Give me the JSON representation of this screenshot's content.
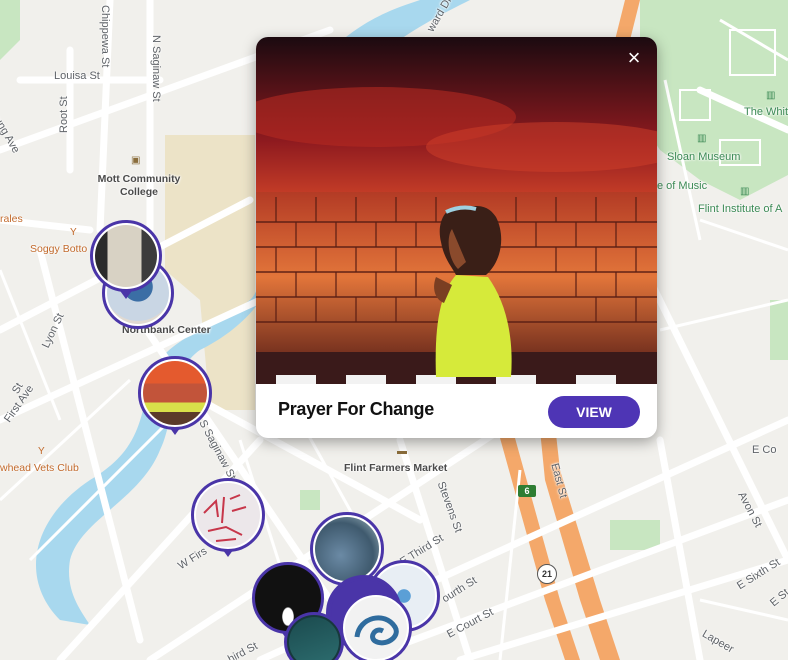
{
  "map": {
    "street_labels": {
      "louisa": "Louisa St",
      "chippewa": "Chippewa St",
      "n_saginaw": "N Saginaw St",
      "root": "Root St",
      "young": "ung Ave",
      "lyon": "Lyon St",
      "first_ave": "First Ave",
      "st_left": "St",
      "s_saginaw": "S Saginaw St",
      "w_first": "W Firs",
      "e_third": "E Third St",
      "stevens": "Stevens St",
      "fourth": "ourth St",
      "e_court": "E Court St",
      "third_bottom": "hird St",
      "east_st": "East St",
      "e_sixth": "E Sixth St",
      "e_co": "E Co",
      "avon": "Avon St",
      "e_st": "E St",
      "lapeer": "Lapeer",
      "ward_dr": "ward Dr"
    },
    "place_labels": {
      "mott_college": "Mott Community College",
      "northbank": "Northbank Center",
      "flint_farmers": "Flint Farmers Market",
      "sloan": "Sloan Museum",
      "music": "e of Music",
      "flint_institute": "Flint Institute of A",
      "the_whit": "The Whit",
      "soggy": "Soggy Botto",
      "ales": "rales",
      "vets_club": "whead Vets Club"
    },
    "route_shields": {
      "highway_475": "6",
      "route_21": "21"
    }
  },
  "popup": {
    "title": "Prayer For Change",
    "view_label": "VIEW",
    "close_icon": "×"
  },
  "colors": {
    "accent": "#4e35b5",
    "marker_ring": "#4a35a8",
    "water": "#a8d8ee",
    "park": "#c8e6c1",
    "highway": "#f4a86a"
  }
}
